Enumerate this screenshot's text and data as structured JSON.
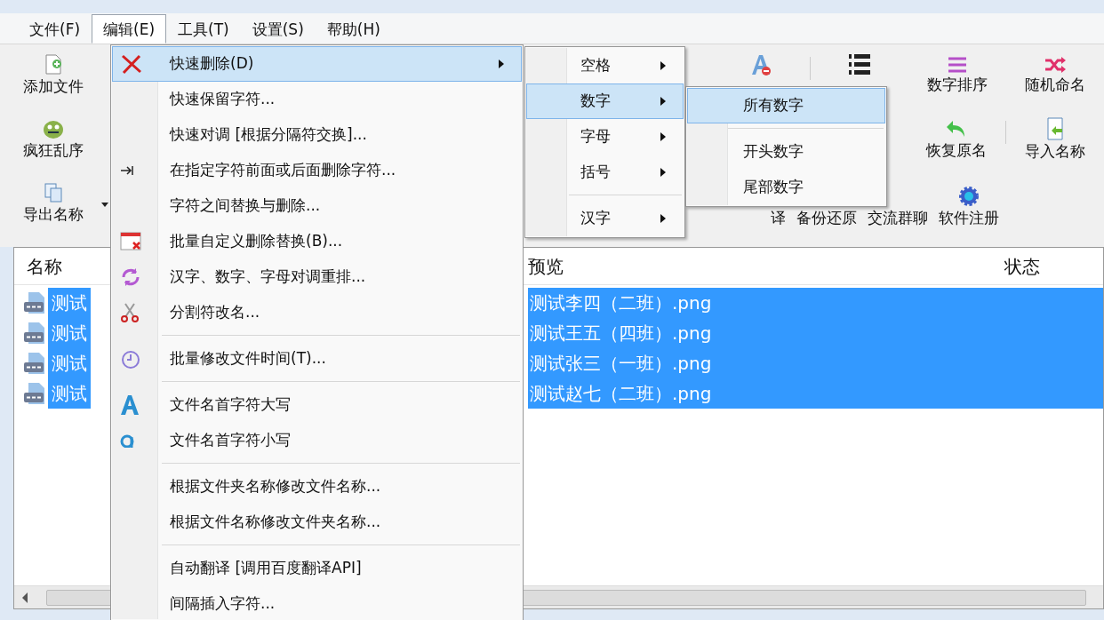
{
  "menubar": [
    {
      "label": "文件(F)",
      "selected": false
    },
    {
      "label": "编辑(E)",
      "selected": true
    },
    {
      "label": "工具(T)",
      "selected": false
    },
    {
      "label": "设置(S)",
      "selected": false
    },
    {
      "label": "帮助(H)",
      "selected": false
    }
  ],
  "toolbar": {
    "rows": [
      {
        "left": [
          {
            "label": "添加文件"
          }
        ],
        "right": [
          {
            "kind": "icon"
          },
          {
            "kind": "icon"
          },
          {
            "kind": "button",
            "label": "数字排序"
          },
          {
            "kind": "button",
            "label": "随机命名"
          }
        ]
      },
      {
        "left": [
          {
            "label": "疯狂乱序"
          }
        ],
        "right": [
          {
            "label": "恢复原名"
          },
          {
            "label": "导入名称"
          }
        ]
      },
      {
        "left": [
          {
            "label": "导出名称",
            "dropdown": true
          }
        ],
        "right": [
          {
            "label": "译"
          },
          {
            "label": "备份还原"
          },
          {
            "label": "交流群聊"
          },
          {
            "label": "软件注册"
          }
        ]
      }
    ]
  },
  "file_list": {
    "columns": [
      "名称",
      "预览",
      "状态"
    ],
    "rows": [
      {
        "name": "测试",
        "preview": "测试李四（二班）.png",
        "selected": true
      },
      {
        "name": "测试",
        "preview": "测试王五（四班）.png",
        "selected": true
      },
      {
        "name": "测试",
        "preview": "测试张三（一班）.png",
        "selected": true
      },
      {
        "name": "测试",
        "preview": "测试赵七（二班）.png",
        "selected": true
      }
    ]
  },
  "edit_menu": [
    {
      "kind": "item",
      "label": "快速删除(D)",
      "submenu": true,
      "selected": true
    },
    {
      "kind": "item",
      "label": "快速保留字符...",
      "submenu": false,
      "selected": false
    },
    {
      "kind": "item",
      "label": "快速对调 [根据分隔符交换]...",
      "submenu": false,
      "selected": false
    },
    {
      "kind": "item",
      "label": "在指定字符前面或后面删除字符...",
      "submenu": false,
      "selected": false
    },
    {
      "kind": "item",
      "label": "字符之间替换与删除...",
      "submenu": false,
      "selected": false
    },
    {
      "kind": "item",
      "label": "批量自定义删除替换(B)...",
      "submenu": false,
      "selected": false
    },
    {
      "kind": "item",
      "label": "汉字、数字、字母对调重排...",
      "submenu": false,
      "selected": false
    },
    {
      "kind": "item",
      "label": "分割符改名...",
      "submenu": false,
      "selected": false
    },
    {
      "kind": "separator"
    },
    {
      "kind": "item",
      "label": "批量修改文件时间(T)...",
      "submenu": false,
      "selected": false
    },
    {
      "kind": "separator"
    },
    {
      "kind": "item",
      "label": "文件名首字符大写",
      "submenu": false,
      "selected": false
    },
    {
      "kind": "item",
      "label": "文件名首字符小写",
      "submenu": false,
      "selected": false
    },
    {
      "kind": "separator"
    },
    {
      "kind": "item",
      "label": "根据文件夹名称修改文件名称...",
      "submenu": false,
      "selected": false
    },
    {
      "kind": "item",
      "label": "根据文件名称修改文件夹名称...",
      "submenu": false,
      "selected": false
    },
    {
      "kind": "separator"
    },
    {
      "kind": "item",
      "label": "自动翻译 [调用百度翻译API]",
      "submenu": false,
      "selected": false
    },
    {
      "kind": "item",
      "label": "间隔插入字符...",
      "submenu": false,
      "selected": false
    }
  ],
  "delete_submenu": [
    {
      "kind": "item",
      "label": "空格",
      "submenu": true,
      "selected": false
    },
    {
      "kind": "item",
      "label": "数字",
      "submenu": true,
      "selected": true
    },
    {
      "kind": "item",
      "label": "字母",
      "submenu": true,
      "selected": false
    },
    {
      "kind": "item",
      "label": "括号",
      "submenu": true,
      "selected": false
    },
    {
      "kind": "separator"
    },
    {
      "kind": "item",
      "label": "汉字",
      "submenu": true,
      "selected": false
    }
  ],
  "digits_submenu": [
    {
      "kind": "item",
      "label": "所有数字",
      "submenu": false,
      "selected": true
    },
    {
      "kind": "separator"
    },
    {
      "kind": "item",
      "label": "开头数字",
      "submenu": false,
      "selected": false
    },
    {
      "kind": "item",
      "label": "尾部数字",
      "submenu": false,
      "selected": false
    }
  ]
}
